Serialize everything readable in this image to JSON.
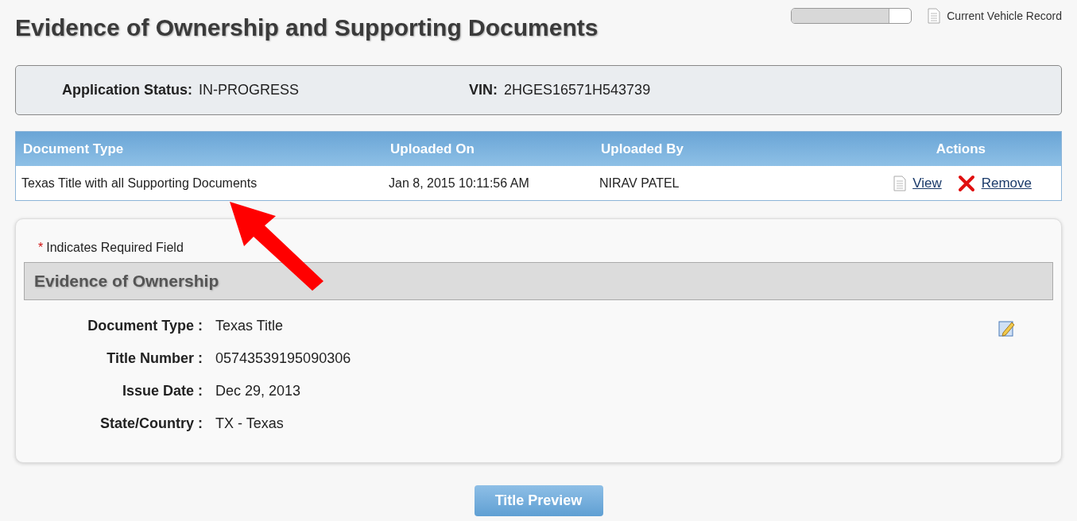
{
  "page_title": "Evidence of Ownership and Supporting Documents",
  "progress": {
    "level": 0.82
  },
  "record_link": "Current Vehicle Record",
  "status": [
    {
      "label": "Application Status:",
      "value": "IN-PROGRESS"
    },
    {
      "label": "VIN:",
      "value": "2HGES16571H543739"
    }
  ],
  "table": {
    "columns": [
      "Document Type",
      "Uploaded On",
      "Uploaded By",
      "Actions"
    ],
    "rows": [
      {
        "document_type": "Texas Title with all Supporting Documents",
        "uploaded_on": "Jan 8, 2015 10:11:56 AM",
        "uploaded_by": "NIRAV PATEL",
        "actions": [
          "View",
          "Remove"
        ]
      }
    ]
  },
  "required_note": {
    "marker": "*",
    "text": "Indicates Required Field"
  },
  "section": {
    "title": "Evidence of Ownership",
    "fields": [
      {
        "label": "Document Type :",
        "value": "Texas Title"
      },
      {
        "label": "Title Number :",
        "value": "05743539195090306"
      },
      {
        "label": "Issue Date :",
        "value": "Dec 29, 2013"
      },
      {
        "label": "State/Country :",
        "value": "TX - Texas"
      }
    ]
  },
  "button": "Title Preview"
}
